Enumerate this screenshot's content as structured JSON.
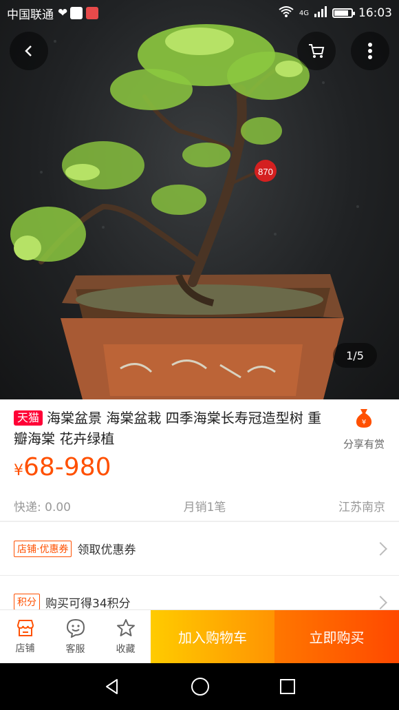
{
  "status_bar": {
    "carrier": "中国联通",
    "network": "4G",
    "time": "16:03",
    "battery_level": 0.85
  },
  "image": {
    "pot_tag": "870",
    "pot_inscription": "",
    "page_indicator": "1/5"
  },
  "product": {
    "badge": "天猫",
    "title": "海棠盆景 海棠盆栽 四季海棠长寿冠造型树 重瓣海棠 花卉绿植",
    "share_label": "分享有赏",
    "currency": "¥",
    "price": "68-980",
    "shipping": "快递: 0.00",
    "monthly_sales": "月销1笔",
    "location": "江苏南京"
  },
  "rows": {
    "coupon_tag": "店铺·优惠券",
    "coupon_label": "领取优惠券",
    "points_tag": "积分",
    "points_label": "购买可得34积分"
  },
  "actions": {
    "shop": "店铺",
    "service": "客服",
    "favorite": "收藏",
    "add_to_cart": "加入购物车",
    "buy_now": "立即购买"
  },
  "colors": {
    "accent": "#ff5000",
    "tmall_red": "#ff0036",
    "cart_yellow": "#ffa200",
    "buy_orange": "#ff5a00"
  },
  "icons": [
    "back-icon",
    "cart-icon",
    "more-icon",
    "money-bag-icon",
    "shop-icon",
    "service-icon",
    "star-icon",
    "back-triangle-icon",
    "home-circle-icon",
    "recents-square-icon"
  ]
}
